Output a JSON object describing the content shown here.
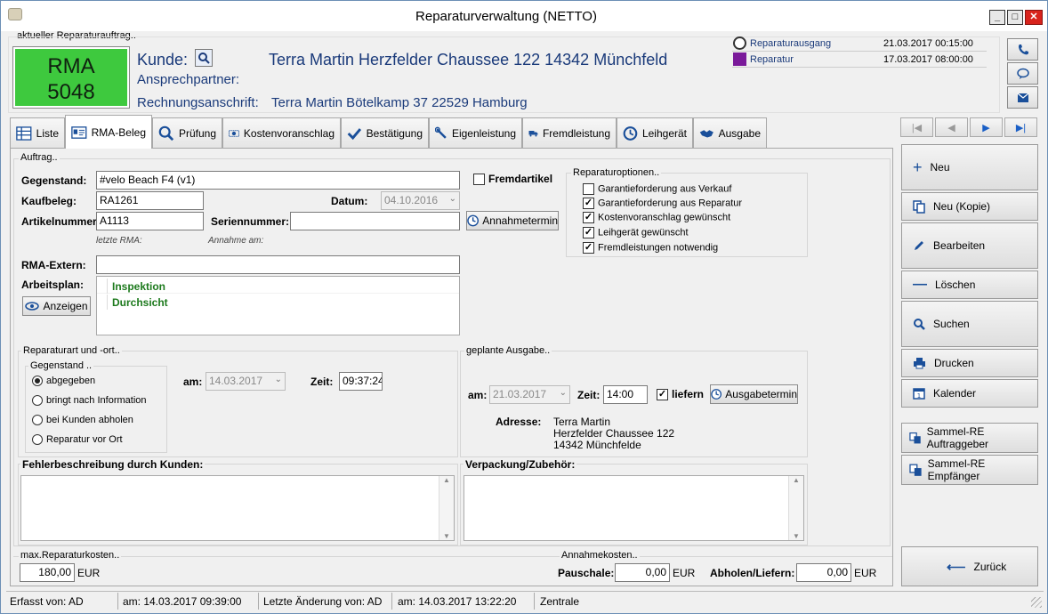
{
  "window": {
    "title": "Reparaturverwaltung (NETTO)"
  },
  "header": {
    "group_label": "aktueller Reparaturauftrag..",
    "rma_line1": "RMA",
    "rma_line2": "5048",
    "kunde_label": "Kunde:",
    "kunde_value": "Terra Martin Herzfelder Chaussee 122   14342 Münchfeld",
    "ansprech_label": "Ansprechpartner:",
    "rechnung_label": "Rechnungsanschrift:",
    "rechnung_value": "Terra Martin Bötelkamp 37    22529 Hamburg",
    "events": [
      {
        "label": "Reparaturausgang",
        "date": "21.03.2017 00:15:00"
      },
      {
        "label": "Reparatur",
        "date": "17.03.2017 08:00:00"
      }
    ]
  },
  "tabs": [
    {
      "label": "Liste"
    },
    {
      "label": "RMA-Beleg"
    },
    {
      "label": "Prüfung"
    },
    {
      "label": "Kostenvoranschlag"
    },
    {
      "label": "Bestätigung"
    },
    {
      "label": "Eigenleistung"
    },
    {
      "label": "Fremdleistung"
    },
    {
      "label": "Leihgerät"
    },
    {
      "label": "Ausgabe"
    }
  ],
  "auftrag": {
    "group_label": "Auftrag..",
    "gegenstand_label": "Gegenstand:",
    "gegenstand_value": "#velo Beach F4 (v1)",
    "fremdartikel_label": "Fremdartikel",
    "kaufbeleg_label": "Kaufbeleg:",
    "kaufbeleg_value": "RA1261",
    "datum_label": "Datum:",
    "datum_value": "04.10.2016",
    "artikelnr_label": "Artikelnummer:",
    "artikelnr_value": "A1113",
    "seriennr_label": "Seriennummer:",
    "seriennr_value": "",
    "annahmetermin_label": "Annahmetermin",
    "letzte_rma_label": "letzte RMA:",
    "annahme_am_label": "Annahme am:",
    "rma_extern_label": "RMA-Extern:",
    "rma_extern_value": "",
    "arbeitsplan_label": "Arbeitsplan:",
    "anzeigen_label": "Anzeigen",
    "arbeitsplan_items": [
      "Inspektion",
      "Durchsicht"
    ]
  },
  "optionen": {
    "group_label": "Reparaturoptionen..",
    "items": [
      {
        "label": "Garantieforderung aus Verkauf",
        "checked": false
      },
      {
        "label": "Garantieforderung aus Reparatur",
        "checked": true
      },
      {
        "label": "Kostenvoranschlag gewünscht",
        "checked": true
      },
      {
        "label": "Leihgerät gewünscht",
        "checked": true
      },
      {
        "label": "Fremdleistungen notwendig",
        "checked": true
      }
    ]
  },
  "reparaturart": {
    "group_label": "Reparaturart und -ort..",
    "sub_label": "Gegenstand ..",
    "radios": [
      {
        "label": "abgegeben",
        "selected": true
      },
      {
        "label": "bringt nach Information",
        "selected": false
      },
      {
        "label": "bei Kunden abholen",
        "selected": false
      },
      {
        "label": "Reparatur vor Ort",
        "selected": false
      }
    ],
    "am_label": "am:",
    "am_value": "14.03.2017",
    "zeit_label": "Zeit:",
    "zeit_value": "09:37:24"
  },
  "ausgabe": {
    "group_label": "geplante Ausgabe..",
    "am_label": "am:",
    "am_value": "21.03.2017",
    "zeit_label": "Zeit:",
    "zeit_value": "14:00",
    "liefern_label": "liefern",
    "ausgabetermin_label": "Ausgabetermin",
    "adresse_label": "Adresse:",
    "adresse_lines": [
      "Terra Martin",
      "Herzfelder Chaussee 122",
      "14342 Münchfelde"
    ]
  },
  "fehler": {
    "label": "Fehlerbeschreibung durch Kunden:"
  },
  "verpackung": {
    "label": "Verpackung/Zubehör:"
  },
  "kosten": {
    "max_label": "max.Reparaturkosten..",
    "max_value": "180,00",
    "currency": "EUR",
    "annahme_label": "Annahmekosten..",
    "pauschale_label": "Pauschale:",
    "pauschale_value": "0,00",
    "abholen_label": "Abholen/Liefern:",
    "abholen_value": "0,00"
  },
  "sidebar": {
    "buttons": [
      {
        "label": "Neu"
      },
      {
        "label": "Neu (Kopie)"
      },
      {
        "label": "Bearbeiten"
      },
      {
        "label": "Löschen"
      },
      {
        "label": "Suchen"
      },
      {
        "label": "Drucken"
      },
      {
        "label": "Kalender"
      },
      {
        "label": "Sammel-RE Auftraggeber"
      },
      {
        "label": "Sammel-RE Empfänger"
      }
    ],
    "zurueck_label": "Zurück"
  },
  "status": {
    "erfasst_von": "Erfasst von: AD",
    "erfasst_am": "am: 14.03.2017 09:39:00",
    "aenderung_von": "Letzte Änderung von: AD",
    "aenderung_am": "am: 14.03.2017 13:22:20",
    "ort": "Zentrale"
  },
  "colors": {
    "rma_badge": "#3ec93e",
    "accent": "#1a3a7a",
    "arbeitsplan_text": "#1d7a1d"
  }
}
